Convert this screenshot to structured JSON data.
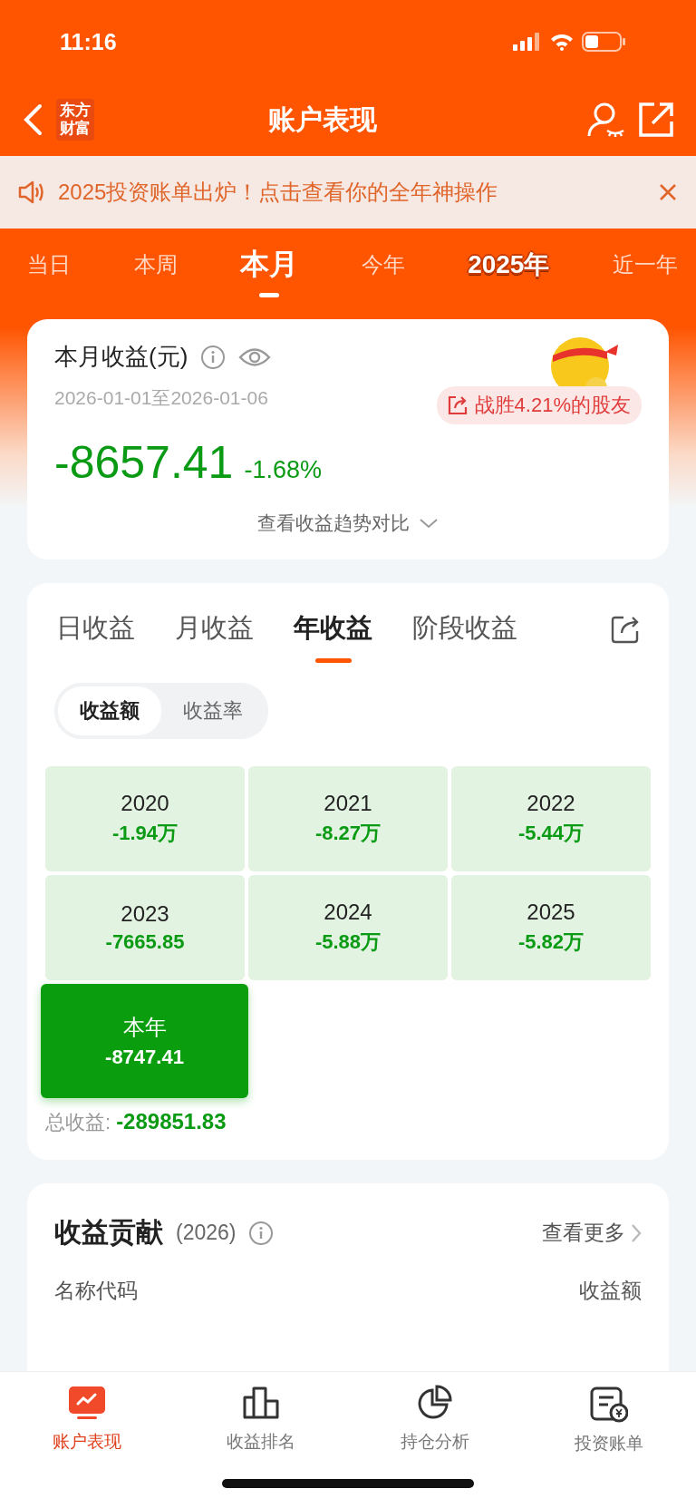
{
  "status_bar": {
    "time": "11:16"
  },
  "header": {
    "logo": [
      "东方",
      "财富"
    ],
    "title": "账户表现"
  },
  "banner": {
    "text": "2025投资账单出炉！点击查看你的全年神操作"
  },
  "periods": [
    {
      "label": "当日",
      "selected": false,
      "kind": "plain"
    },
    {
      "label": "本周",
      "selected": false,
      "kind": "plain"
    },
    {
      "label": "本月",
      "selected": true,
      "kind": "plain"
    },
    {
      "label": "今年",
      "selected": false,
      "kind": "plain"
    },
    {
      "label": "2025年",
      "selected": false,
      "kind": "promo"
    },
    {
      "label": "近一年",
      "selected": false,
      "kind": "plain"
    }
  ],
  "summary": {
    "title": "本月收益(元)",
    "date_range": "2026-01-01至2026-01-06",
    "rank_badge": "战胜4.21%的股友",
    "amount": "-8657.41",
    "rate": "-1.68%",
    "trend_link": "查看收益趋势对比"
  },
  "earnings": {
    "tabs": [
      {
        "label": "日收益",
        "selected": false
      },
      {
        "label": "月收益",
        "selected": false
      },
      {
        "label": "年收益",
        "selected": true
      },
      {
        "label": "阶段收益",
        "selected": false
      }
    ],
    "modes": [
      {
        "label": "收益额",
        "selected": true
      },
      {
        "label": "收益率",
        "selected": false
      }
    ],
    "years": [
      {
        "label": "2020",
        "value": "-1.94万",
        "selected": false
      },
      {
        "label": "2021",
        "value": "-8.27万",
        "selected": false
      },
      {
        "label": "2022",
        "value": "-5.44万",
        "selected": false
      },
      {
        "label": "2023",
        "value": "-7665.85",
        "selected": false
      },
      {
        "label": "2024",
        "value": "-5.88万",
        "selected": false
      },
      {
        "label": "2025",
        "value": "-5.82万",
        "selected": false
      },
      {
        "label": "本年",
        "value": "-8747.41",
        "selected": true
      }
    ],
    "total_label": "总收益:",
    "total_value": "-289851.83"
  },
  "contribution": {
    "title": "收益贡献",
    "year": "(2026)",
    "more": "查看更多",
    "columns": [
      "名称代码",
      "收益额"
    ]
  },
  "tab_bar": [
    {
      "label": "账户表现",
      "selected": true,
      "kind": "trend"
    },
    {
      "label": "收益排名",
      "selected": false,
      "kind": "bars"
    },
    {
      "label": "持仓分析",
      "selected": false,
      "kind": "pie"
    },
    {
      "label": "投资账单",
      "selected": false,
      "kind": "bill"
    }
  ]
}
